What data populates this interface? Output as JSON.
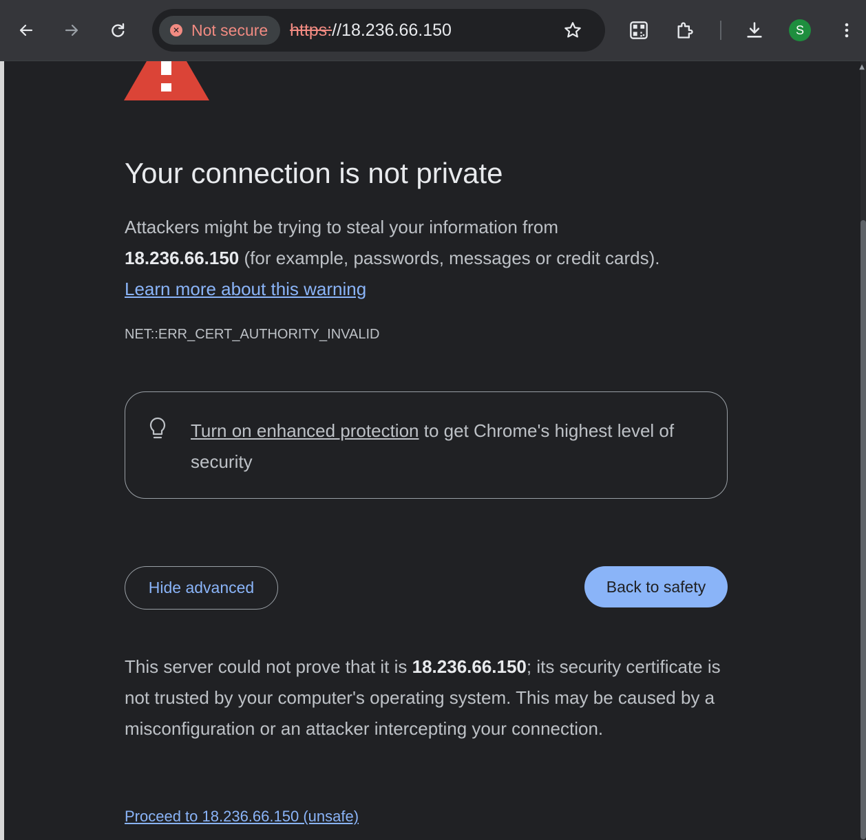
{
  "browser": {
    "security_chip": "Not secure",
    "url_scheme": "https:",
    "url_rest": "//18.236.66.150",
    "profile_initial": "S",
    "icons": [
      "back-arrow-icon",
      "forward-arrow-icon",
      "reload-icon",
      "warning-circle-icon",
      "star-icon",
      "qr-code-icon",
      "extensions-icon",
      "download-icon",
      "more-vert-icon"
    ]
  },
  "page": {
    "title": "Your connection is not private",
    "intro_line1": "Attackers might be trying to steal your information from",
    "host": "18.236.66.150",
    "intro_line2_rest": " (for example, passwords, messages or credit cards).",
    "learn_more": "Learn more about this warning",
    "error_code": "NET::ERR_CERT_AUTHORITY_INVALID",
    "protection_link": "Turn on enhanced protection",
    "protection_rest": " to get Chrome's highest level of security",
    "hide_advanced": "Hide advanced",
    "back_to_safety": "Back to safety",
    "details_prefix": "This server could not prove that it is ",
    "details_host": "18.236.66.150",
    "details_rest": "; its security certificate is not trusted by your computer's operating system. This may be caused by a misconfiguration or an attacker intercepting your connection.",
    "proceed_link": "Proceed to 18.236.66.150 (unsafe)"
  },
  "colors": {
    "background": "#202124",
    "toolbar": "#35363a",
    "warning_red": "#db4437",
    "link_blue": "#8ab4f8",
    "not_secure_red": "#f28b82",
    "profile_green": "#1e8e3e"
  }
}
